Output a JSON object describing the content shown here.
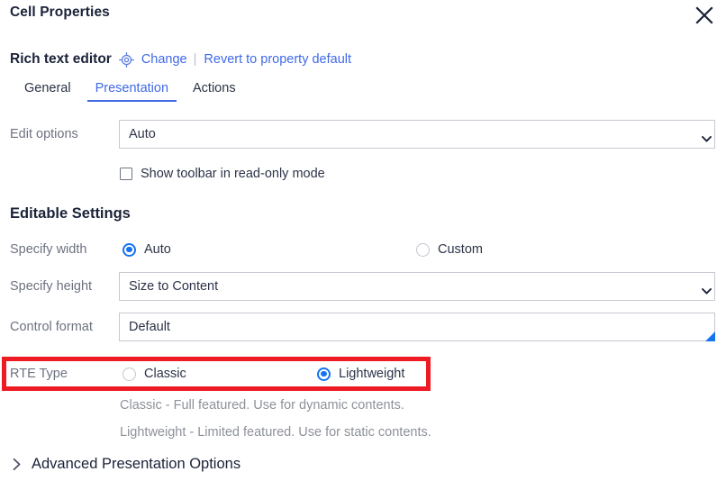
{
  "header": {
    "title": "Cell Properties",
    "close_icon": "close-icon"
  },
  "property": {
    "name": "Rich text editor",
    "target_icon": "target-icon",
    "change_label": "Change",
    "separator": "|",
    "revert_label": "Revert to property default"
  },
  "tabs": [
    {
      "label": "General",
      "active": false
    },
    {
      "label": "Presentation",
      "active": true
    },
    {
      "label": "Actions",
      "active": false
    }
  ],
  "edit_options": {
    "label": "Edit options",
    "value": "Auto",
    "chevron_icon": "chevron-down-icon"
  },
  "show_toolbar": {
    "label": "Show toolbar in read-only mode",
    "checked": false
  },
  "editable_settings": {
    "heading": "Editable Settings",
    "specify_width": {
      "label": "Specify width",
      "options": [
        {
          "label": "Auto",
          "selected": true
        },
        {
          "label": "Custom",
          "selected": false
        }
      ]
    },
    "specify_height": {
      "label": "Specify height",
      "value": "Size to Content",
      "chevron_icon": "chevron-down-icon"
    },
    "control_format": {
      "label": "Control format",
      "value": "Default",
      "marker_icon": "corner-triangle-icon"
    },
    "rte_type": {
      "label": "RTE Type",
      "options": [
        {
          "label": "Classic",
          "selected": false
        },
        {
          "label": "Lightweight",
          "selected": true
        }
      ],
      "hints": [
        "Classic - Full featured. Use for dynamic contents.",
        "Lightweight - Limited featured. Use for static contents."
      ]
    }
  },
  "advanced": {
    "label": "Advanced Presentation Options",
    "chevron_icon": "chevron-right-icon",
    "expanded": false
  },
  "colors": {
    "accent": "#3f6ae8",
    "radio_accent": "#1673f0",
    "highlight": "#ee1b24",
    "text": "#2c3347",
    "muted": "#6d7280"
  }
}
